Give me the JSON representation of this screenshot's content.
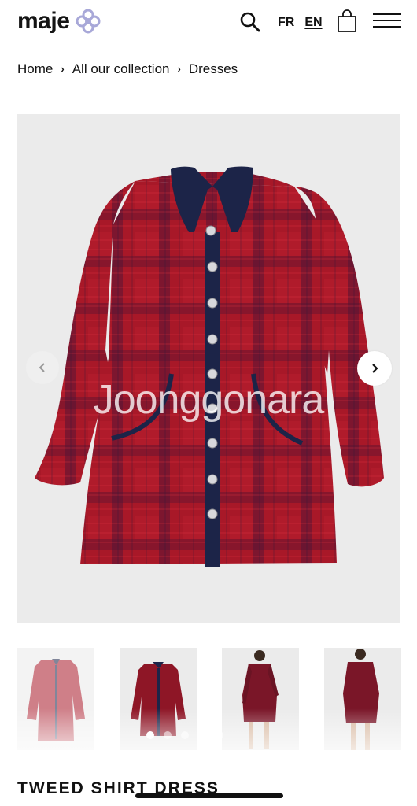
{
  "header": {
    "logo_text": "maje",
    "lang_fr": "FR",
    "lang_en": "EN"
  },
  "breadcrumb": {
    "items": [
      "Home",
      "All our collection",
      "Dresses"
    ]
  },
  "gallery": {
    "watermark": "Joonggonara",
    "thumbnail_count": 4,
    "dot_count": 5,
    "active_dot": 1
  },
  "product": {
    "title": "TWEED SHIRT DRESS"
  },
  "colors": {
    "tweed_red": "#a81828",
    "navy_trim": "#1c2448",
    "background_grey": "#ebebeb"
  }
}
